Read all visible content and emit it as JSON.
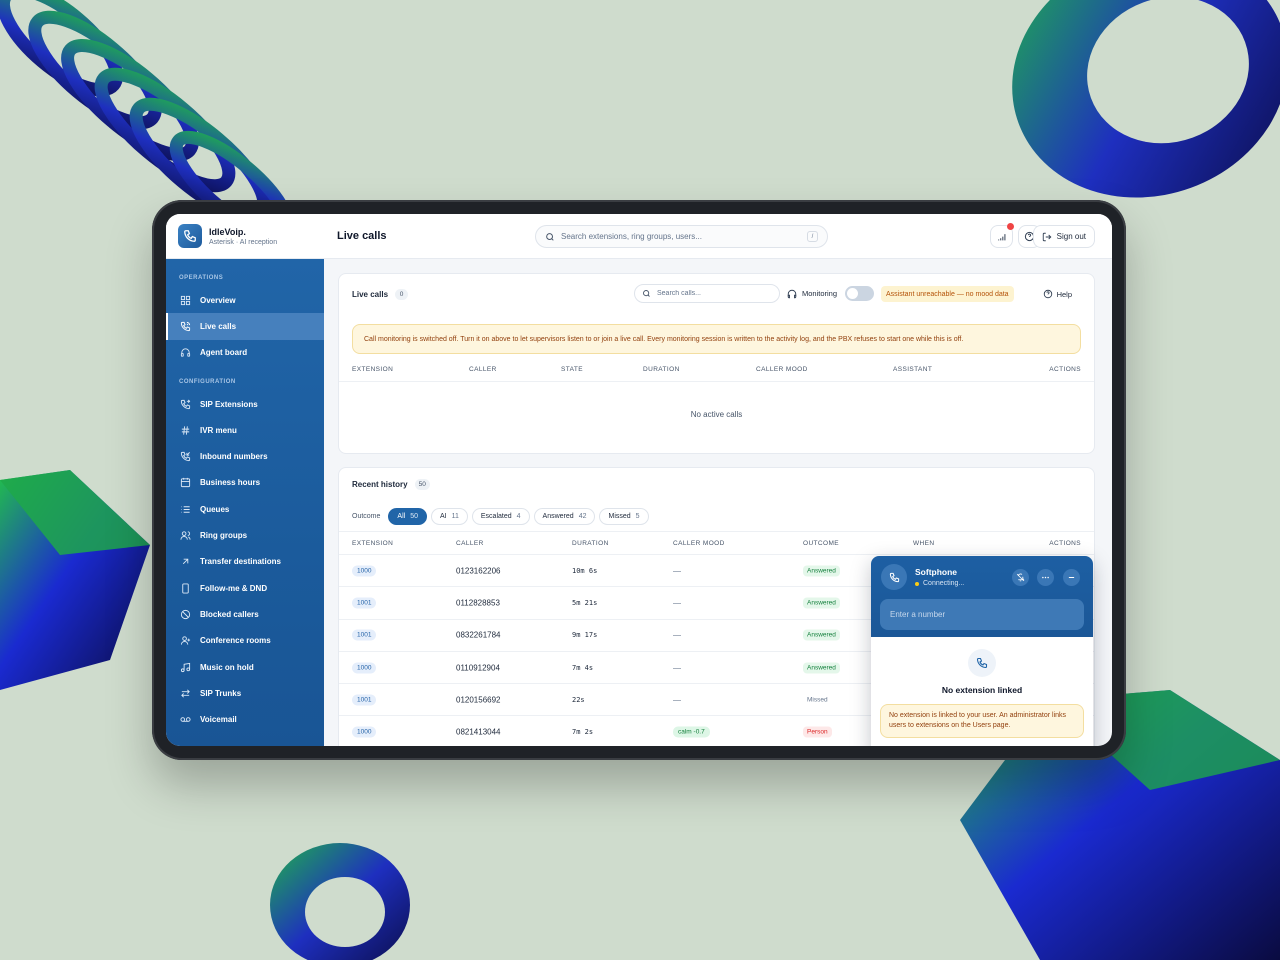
{
  "brand": {
    "name": "IdleVoip.",
    "subtitle": "Asterisk · AI reception"
  },
  "sidebar": {
    "sections": [
      {
        "label": "OPERATIONS",
        "items": [
          {
            "label": "Overview",
            "icon": "grid-icon"
          },
          {
            "label": "Live calls",
            "icon": "phone-call-icon",
            "active": true
          },
          {
            "label": "Agent board",
            "icon": "headset-icon"
          }
        ]
      },
      {
        "label": "CONFIGURATION",
        "items": [
          {
            "label": "SIP Extensions",
            "icon": "phone-forward-icon"
          },
          {
            "label": "IVR menu",
            "icon": "hash-icon"
          },
          {
            "label": "Inbound numbers",
            "icon": "phone-incoming-icon"
          },
          {
            "label": "Business hours",
            "icon": "calendar-clock-icon"
          },
          {
            "label": "Queues",
            "icon": "list-icon"
          },
          {
            "label": "Ring groups",
            "icon": "users-icon"
          },
          {
            "label": "Transfer destinations",
            "icon": "arrow-up-right-icon"
          },
          {
            "label": "Follow-me & DND",
            "icon": "smartphone-icon"
          },
          {
            "label": "Blocked callers",
            "icon": "ban-icon"
          },
          {
            "label": "Conference rooms",
            "icon": "users-round-icon"
          },
          {
            "label": "Music on hold",
            "icon": "music-icon"
          },
          {
            "label": "SIP Trunks",
            "icon": "arrows-exchange-icon"
          },
          {
            "label": "Voicemail",
            "icon": "voicemail-icon"
          }
        ]
      }
    ]
  },
  "topbar": {
    "title": "Live calls",
    "search_placeholder": "Search extensions, ring groups, users...",
    "search_shortcut": "/",
    "signout_label": "Sign out"
  },
  "live_calls": {
    "title": "Live calls",
    "count": "0",
    "search_placeholder": "Search calls...",
    "monitoring_label": "Monitoring",
    "monitoring_on": false,
    "assistant_status": "Assistant unreachable — no mood data",
    "help_label": "Help",
    "banner": "Call monitoring is switched off. Turn it on above to let supervisors listen to or join a live call. Every monitoring session is written to the activity log, and the PBX refuses to start one while this is off.",
    "columns": [
      "EXTENSION",
      "CALLER",
      "STATE",
      "DURATION",
      "CALLER MOOD",
      "ASSISTANT",
      "ACTIONS"
    ],
    "empty_text": "No active calls"
  },
  "history": {
    "title": "Recent history",
    "count": "50",
    "filter_label": "Outcome",
    "filters": [
      {
        "label": "All",
        "count": "50",
        "active": true
      },
      {
        "label": "AI",
        "count": "11"
      },
      {
        "label": "Escalated",
        "count": "4"
      },
      {
        "label": "Answered",
        "count": "42"
      },
      {
        "label": "Missed",
        "count": "5"
      }
    ],
    "columns": [
      "EXTENSION",
      "CALLER",
      "DURATION",
      "CALLER MOOD",
      "OUTCOME",
      "WHEN",
      "ACTIONS"
    ],
    "rows": [
      {
        "ext": "1000",
        "caller": "0123162206",
        "duration": "10m 6s",
        "mood": "—",
        "outcome": "Answered"
      },
      {
        "ext": "1001",
        "caller": "0112828853",
        "duration": "5m 21s",
        "mood": "—",
        "outcome": "Answered"
      },
      {
        "ext": "1001",
        "caller": "0832261784",
        "duration": "9m 17s",
        "mood": "—",
        "outcome": "Answered"
      },
      {
        "ext": "1000",
        "caller": "0110912904",
        "duration": "7m 4s",
        "mood": "—",
        "outcome": "Answered"
      },
      {
        "ext": "1001",
        "caller": "0120156692",
        "duration": "22s",
        "mood": "—",
        "outcome": "Missed"
      },
      {
        "ext": "1000",
        "caller": "0821413044",
        "duration": "7m 2s",
        "mood": "calm -0.7",
        "outcome": "Person"
      }
    ]
  },
  "softphone": {
    "title": "Softphone",
    "status": "Connecting...",
    "number_placeholder": "Enter a number",
    "no_extension_title": "No extension linked",
    "no_extension_text": "No extension is linked to your user. An administrator links users to extensions on the Users page."
  },
  "colors": {
    "primary": "#2165a8",
    "warning_bg": "#fef6de",
    "warning_text": "#92400e",
    "answered": "#15803d",
    "danger": "#ef4444"
  }
}
